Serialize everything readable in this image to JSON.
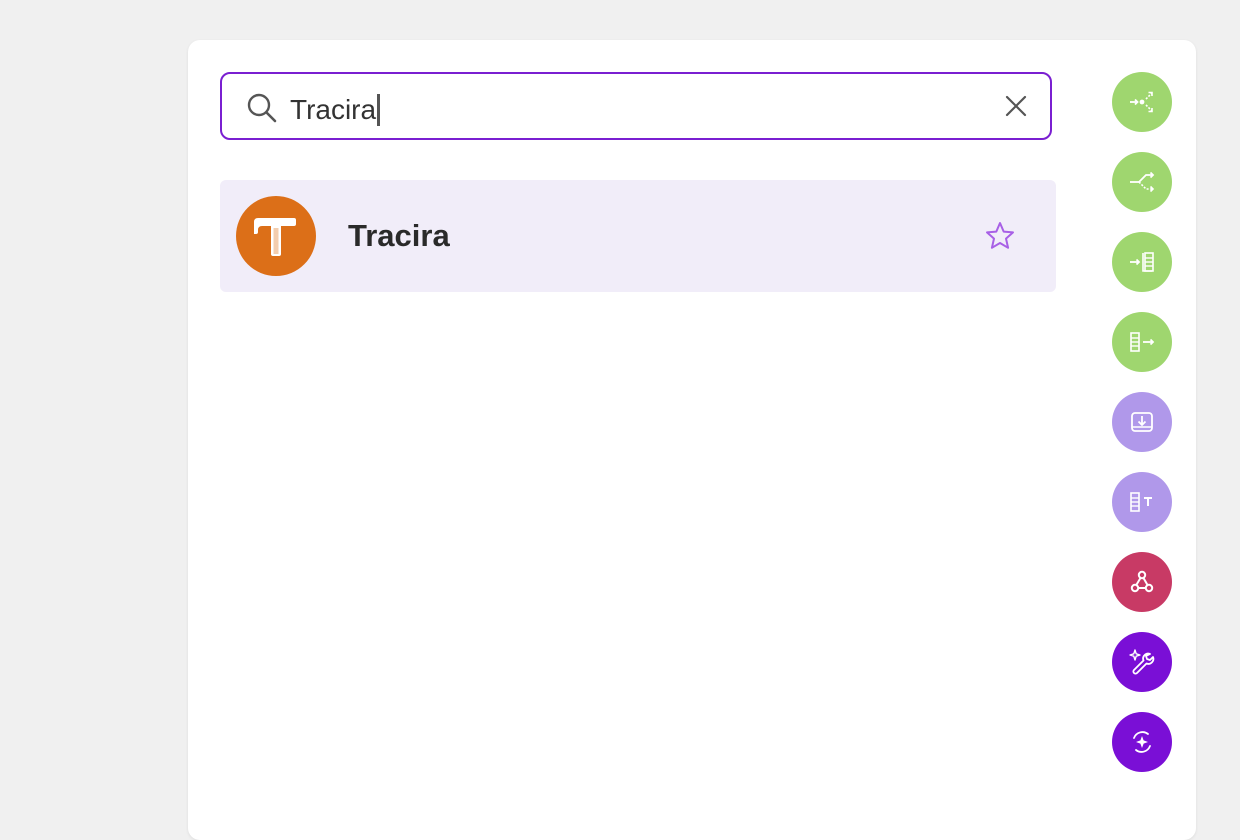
{
  "search": {
    "value": "Tracira",
    "placeholder": ""
  },
  "results": [
    {
      "name": "Tracira",
      "logo_letter": "T",
      "logo_color": "#dc6f18",
      "favorited": false
    }
  ],
  "colors": {
    "accent": "#7a1fd1",
    "row_highlight": "#f1edf9",
    "star": "#a860e6"
  },
  "side_buttons": [
    {
      "icon": "split-flow-icon",
      "color": "#9fd66f"
    },
    {
      "icon": "branch-icon",
      "color": "#9fd66f"
    },
    {
      "icon": "list-input-icon",
      "color": "#9fd66f"
    },
    {
      "icon": "list-output-icon",
      "color": "#9fd66f"
    },
    {
      "icon": "download-tray-icon",
      "color": "#b098ea"
    },
    {
      "icon": "text-list-icon",
      "color": "#b098ea"
    },
    {
      "icon": "webhook-icon",
      "color": "#c83a65"
    },
    {
      "icon": "magic-wrench-icon",
      "color": "#7a0fd6"
    },
    {
      "icon": "ai-spark-icon",
      "color": "#7a0fd6"
    }
  ]
}
